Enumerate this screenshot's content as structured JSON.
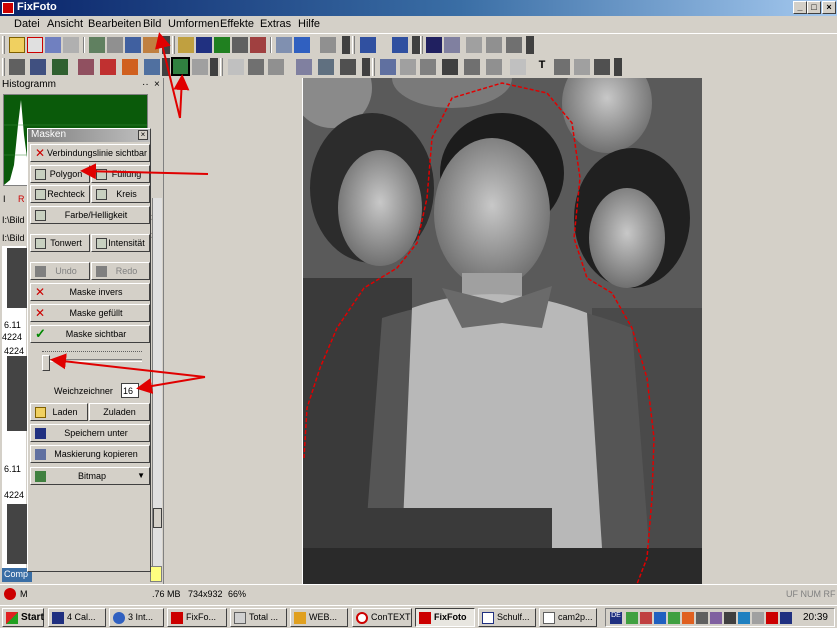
{
  "window": {
    "title": "FixFoto"
  },
  "menu": [
    "Datei",
    "Ansicht",
    "Bearbeiten",
    "Bild",
    "Umformen",
    "Effekte",
    "Extras",
    "Hilfe"
  ],
  "histogram_panel": {
    "title": "Histogramm",
    "pin": "··",
    "close": "×",
    "tab_letters": [
      "I",
      "R"
    ]
  },
  "file_browser": {
    "paths": [
      "I:\\Bild",
      "I:\\Bild"
    ],
    "items": [
      {
        "number": "4224",
        "label": "6.11"
      },
      {
        "number": "4224",
        "label": "6.11"
      },
      {
        "number": "4224",
        "label": ""
      }
    ],
    "bottom_tab": "Comp"
  },
  "masken": {
    "title": "Masken",
    "verbindungslinie": "Verbindungslinie sichtbar",
    "polygon": "Polygon",
    "fuellung": "Füllung",
    "rechteck": "Rechteck",
    "kreis": "Kreis",
    "farbe_helligkeit": "Farbe/Helligkeit",
    "tonwert": "Tonwert",
    "intensitaet": "Intensität",
    "undo": "Undo",
    "redo": "Redo",
    "maske_invers": "Maske invers",
    "maske_gefuellt": "Maske gefüllt",
    "maske_sichtbar": "Maske sichtbar",
    "weichzeichner_label": "Weichzeichner",
    "weichzeichner_value": "16",
    "laden": "Laden",
    "zuladen": "Zuladen",
    "speichern_unter": "Speichern unter",
    "maskierung_kopieren": "Maskierung kopieren",
    "bitmap": "Bitmap"
  },
  "statusbar": {
    "letter": "M",
    "size": ".76 MB",
    "dimensions": "734x932",
    "zoom": "66%",
    "indicators": "UF  NUM  RF"
  },
  "taskbar": {
    "start": "Start",
    "tasks": [
      "4 Cal...",
      "3 Int...",
      "FixFo...",
      "Total ...",
      "WEB...",
      "ConTEXT",
      "FixFoto",
      "Schulf...",
      "cam2p..."
    ],
    "clock": "20:39"
  },
  "colors": {
    "titlebar": "#0a246a",
    "mask_line": "#e00000",
    "annotation_arrow": "#e00000"
  }
}
